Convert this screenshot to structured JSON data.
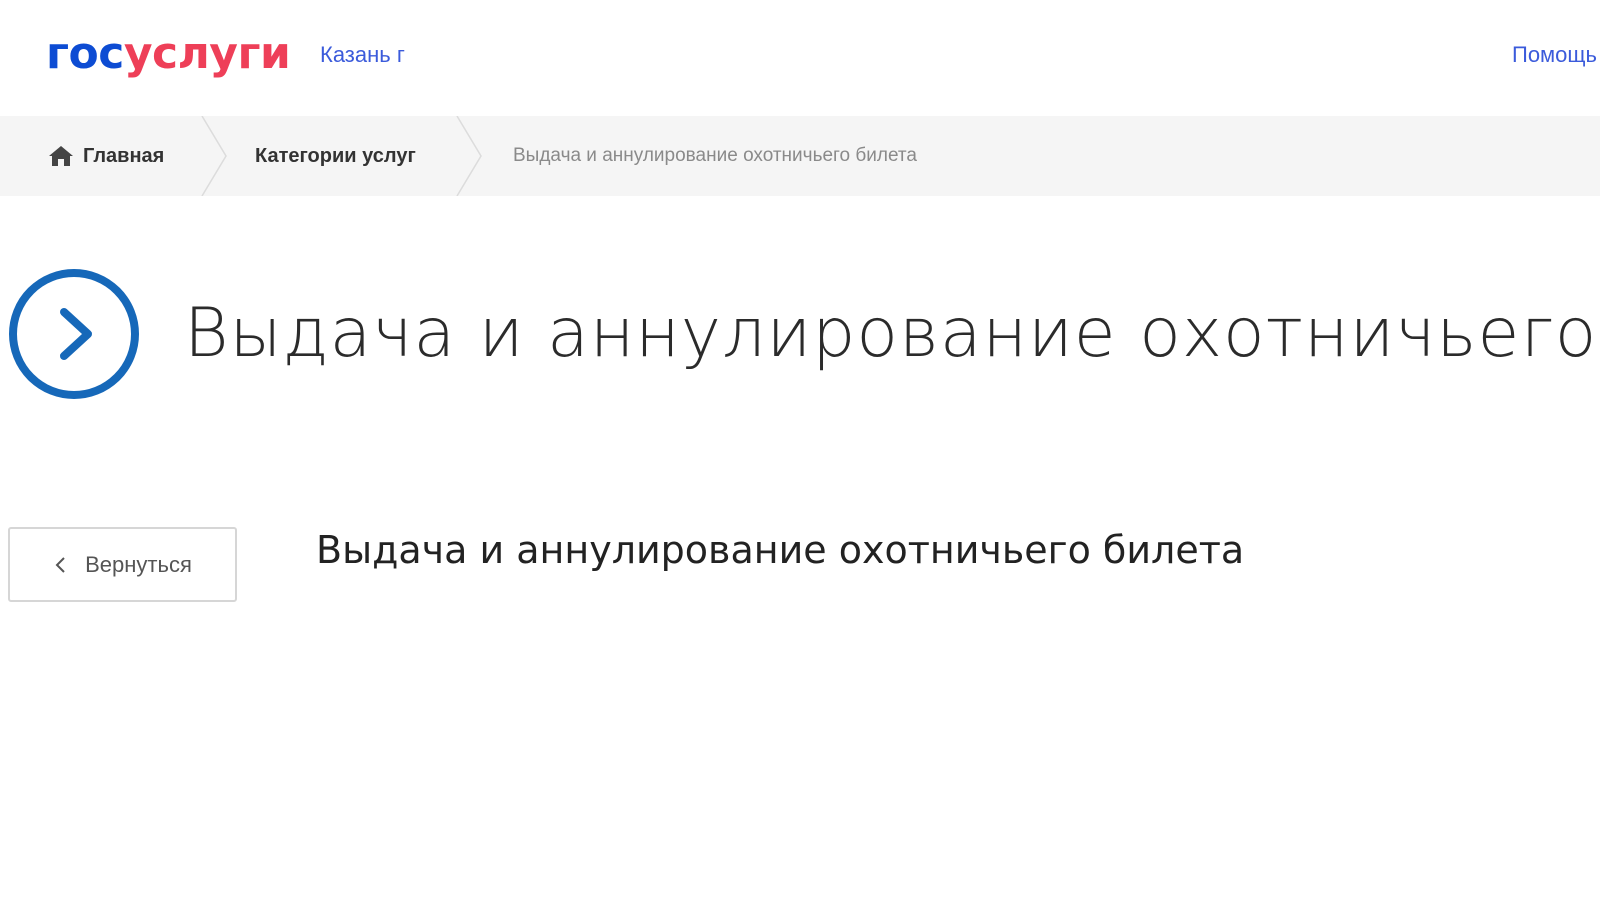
{
  "header": {
    "logo_part1": "гос",
    "logo_part2": "услуги",
    "region": "Казань г",
    "help": "Помощь"
  },
  "breadcrumbs": {
    "home": "Главная",
    "categories": "Категории услуг",
    "current": "Выдача и аннулирование охотничьего билета"
  },
  "main": {
    "title": "Выдача и аннулирование охотничьего билета",
    "back_label": "Вернуться",
    "service_heading": "Выдача и аннулирование охотничьего билета"
  },
  "icons": {
    "home": "home-icon",
    "title": "chevron-circle-right-icon",
    "back": "chevron-left-icon"
  },
  "colors": {
    "brand_blue": "#0d4cd3",
    "brand_red": "#ee3f58",
    "link_blue": "#3b5bdb",
    "icon_blue": "#1668b9",
    "breadcrumb_bg": "#f5f5f5"
  }
}
